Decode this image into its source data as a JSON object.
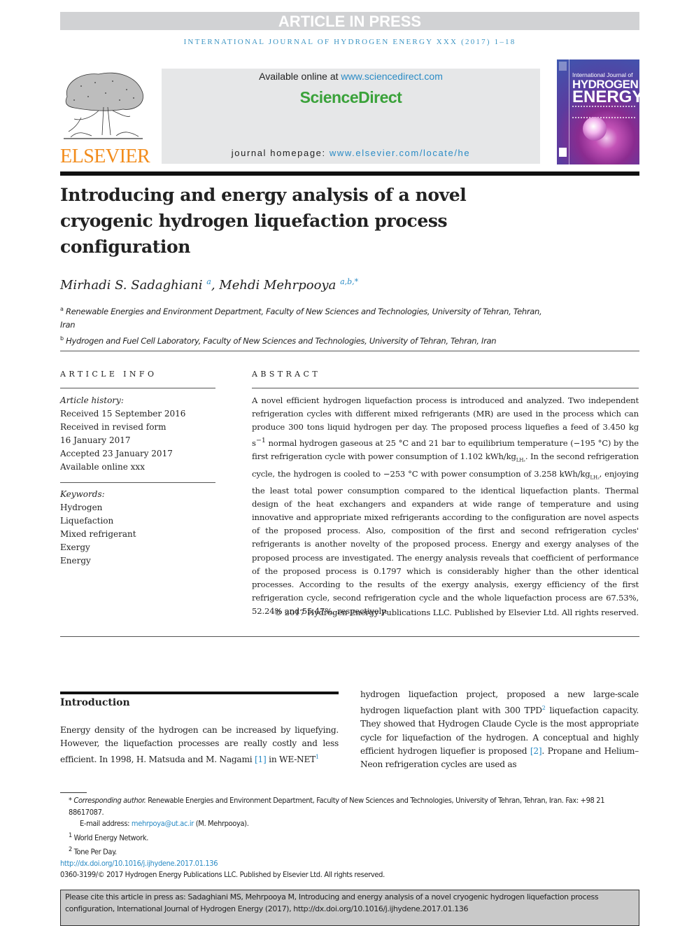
{
  "banner": {
    "label": "ARTICLE IN PRESS"
  },
  "running_head": "INTERNATIONAL JOURNAL OF HYDROGEN ENERGY XXX (2017) 1–18",
  "header": {
    "publisher_logo": "ELSEVIER",
    "available_online_prefix": "Available online at ",
    "available_online_link": "www.sciencedirect.com",
    "platform_name": "ScienceDirect",
    "homepage_prefix": "journal homepage: ",
    "homepage_link": "www.elsevier.com/locate/he",
    "cover": {
      "line1": "International Journal of",
      "line2": "HYDROGEN",
      "line3": "ENERGY"
    }
  },
  "article": {
    "title": "Introducing and energy analysis of a novel cryogenic hydrogen liquefaction process configuration",
    "authors": [
      {
        "name": "Mirhadi S. Sadaghiani",
        "affil": "a"
      },
      {
        "name": "Mehdi Mehrpooya",
        "affil": "a,b,*"
      }
    ],
    "affiliations": [
      {
        "mark": "a",
        "text": "Renewable Energies and Environment Department, Faculty of New Sciences and Technologies, University of Tehran, Tehran, Iran"
      },
      {
        "mark": "b",
        "text": "Hydrogen and Fuel Cell Laboratory, Faculty of New Sciences and Technologies, University of Tehran, Tehran, Iran"
      }
    ]
  },
  "article_info": {
    "heading": "ARTICLE INFO",
    "history_label": "Article history:",
    "history": [
      "Received 15 September 2016",
      "Received in revised form",
      "16 January 2017",
      "Accepted 23 January 2017",
      "Available online xxx"
    ],
    "keywords_label": "Keywords:",
    "keywords": [
      "Hydrogen",
      "Liquefaction",
      "Mixed refrigerant",
      "Exergy",
      "Energy"
    ]
  },
  "abstract": {
    "heading": "ABSTRACT",
    "p1": "A novel efficient hydrogen liquefaction process is introduced and analyzed. Two independent refrigeration cycles with different mixed refrigerants (MR) are used in the process which can produce 300 tons liquid hydrogen per day. The proposed process liquefies a feed of 3.450 kg s",
    "p1_sup": "−1",
    "p2": " normal hydrogen gaseous at 25 °C and 21 bar to equilibrium temperature (−195 °C) by the first refrigeration cycle with power consumption of 1.102 kWh/kg",
    "sub_lh2": "LH₂",
    "p3": ". In the second refrigeration cycle, the hydrogen is cooled to −253 °C with power consumption of 3.258 kWh/kg",
    "p4": ", enjoying the least total power consumption compared to the identical liquefaction plants. Thermal design of the heat exchangers and expanders at wide range of temperature and using innovative and appropriate mixed refrigerants according to the configuration are novel aspects of the proposed process. Also, composition of the first and second refrigeration cycles' refrigerants is another novelty of the proposed process. Energy and exergy analyses of the proposed process are investigated. The energy analysis reveals that coefficient of performance of the proposed process is 0.1797 which is considerably higher than the other identical processes. According to the results of the exergy analysis, exergy efficiency of the first refrigeration cycle, second refrigeration cycle and the whole liquefaction process are 67.53%, 52.24% and 55.47%, respectively.",
    "copyright": "© 2017 Hydrogen Energy Publications LLC. Published by Elsevier Ltd. All rights reserved."
  },
  "introduction": {
    "heading": "Introduction",
    "left_a": "Energy density of the hydrogen can be increased by liquefying. However, the liquefaction processes are really costly and less efficient. In 1998, H. Matsuda and M. Nagami ",
    "ref1": "[1]",
    "left_b": " in WE-NET",
    "fn1": "1",
    "right_a": "hydrogen liquefaction project, proposed a new large-scale hydrogen liquefaction plant with 300 TPD",
    "fn2": "2",
    "right_b": " liquefaction capacity. They showed that Hydrogen Claude Cycle is the most appropriate cycle for liquefaction of the hydrogen. A conceptual and highly efficient hydrogen liquefier is proposed ",
    "ref2": "[2]",
    "right_c": ". Propane and Helium–Neon refrigeration cycles are used as"
  },
  "footnotes": {
    "corresponding_label": "* Corresponding author.",
    "corresponding_text": " Renewable Energies and Environment Department, Faculty of New Sciences and Technologies, University of Tehran, Tehran, Iran. Fax: +98 21 88617087.",
    "email_prefix": "E-mail address: ",
    "email": "mehrpoya@ut.ac.ir",
    "email_suffix": " (M. Mehrpooya).",
    "fn1_mark": "1",
    "fn1_text": " World Energy Network.",
    "fn2_mark": "2",
    "fn2_text": " Tone Per Day.",
    "doi": "http://dx.doi.org/10.1016/j.ijhydene.2017.01.136",
    "issn_line": "0360-3199/© 2017 Hydrogen Energy Publications LLC. Published by Elsevier Ltd. All rights reserved."
  },
  "citation_box": {
    "text": "Please cite this article in press as: Sadaghiani MS, Mehrpooya M, Introducing and energy analysis of a novel cryogenic hydrogen liquefaction process configuration, International Journal of Hydrogen Energy (2017), http://dx.doi.org/10.1016/j.ijhydene.2017.01.136"
  },
  "colors": {
    "link": "#2a8bc5",
    "sciencedirect_green": "#3aa23a",
    "elsevier_orange": "#f28c1b",
    "banner_gray": "#d1d2d4",
    "cite_box_gray": "#c9c9c9"
  }
}
